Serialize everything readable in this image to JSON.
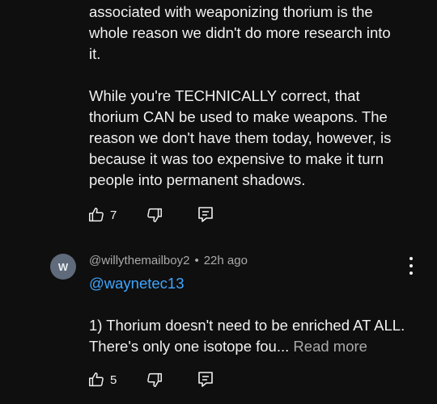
{
  "comment_1": {
    "body": "associated with weaponizing thorium is the\nwhole reason we didn't do more research into\nit.\n\nWhile you're TECHNICALLY correct, that\nthorium CAN be used to make weapons. The\nreason we don't have them today, however, is\nbecause it was too expensive to make it turn\npeople into permanent shadows.",
    "like_count": "7"
  },
  "comment_2": {
    "avatar_letter": "W",
    "author": "@willythemailboy2",
    "separator": "•",
    "time": "22h ago",
    "mention": "@waynetec13",
    "body": "1) Thorium doesn't need to be enriched AT ALL. There's only one isotope fou...",
    "read_more": "Read more",
    "like_count": "5"
  },
  "icons": {
    "like": "thumbs-up-icon",
    "dislike": "thumbs-down-icon",
    "reply": "reply-comment-icon",
    "more": "more-vertical-icon"
  },
  "colors": {
    "background": "#0f0f0f",
    "text": "#f1f1f1",
    "secondary_text": "#aaaaaa",
    "link": "#3ea6ff",
    "avatar_bg": "#5f6b7a"
  }
}
